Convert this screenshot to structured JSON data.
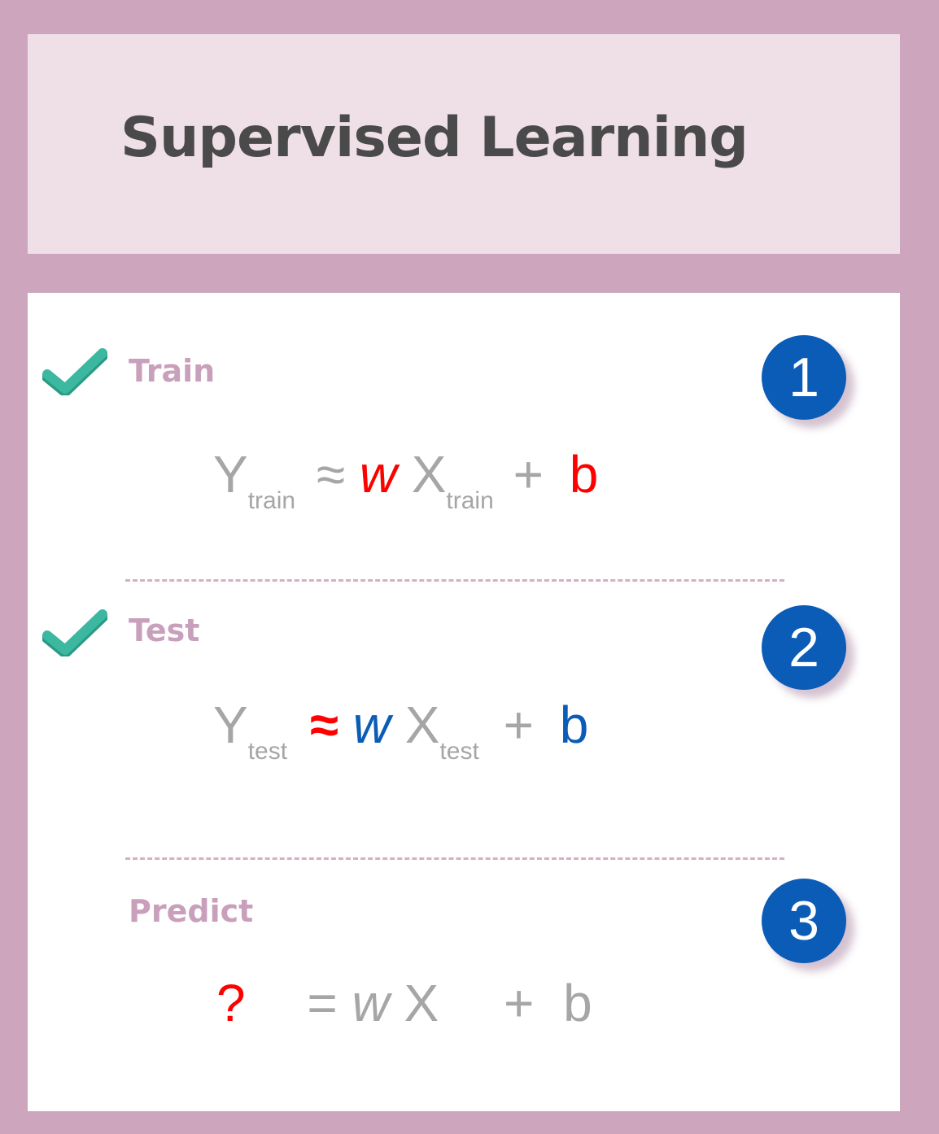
{
  "title": "Supervised Learning",
  "colors": {
    "frame": "#cda6bd",
    "header_bg": "#efdfe7",
    "label": "#c9a0bb",
    "badge": "#0a5cb7",
    "check": "#3cb8a0",
    "highlight_red": "#ff0000",
    "highlight_blue": "#0a5cb7",
    "formula_gray": "#a6a6a6"
  },
  "steps": [
    {
      "label": "Train",
      "number": "1",
      "checked": true,
      "formula": {
        "y": "Y",
        "y_sub": "train",
        "op": "≈",
        "w": "w",
        "x": "X",
        "x_sub": "train",
        "plus": "+",
        "b": "b"
      }
    },
    {
      "label": "Test",
      "number": "2",
      "checked": true,
      "formula": {
        "y": "Y",
        "y_sub": "test",
        "op": "≈",
        "w": "w",
        "x": "X",
        "x_sub": "test",
        "plus": "+",
        "b": "b"
      }
    },
    {
      "label": "Predict",
      "number": "3",
      "checked": false,
      "formula": {
        "y": "?",
        "op": "=",
        "w": "w",
        "x": "X",
        "plus": "+",
        "b": "b"
      }
    }
  ]
}
